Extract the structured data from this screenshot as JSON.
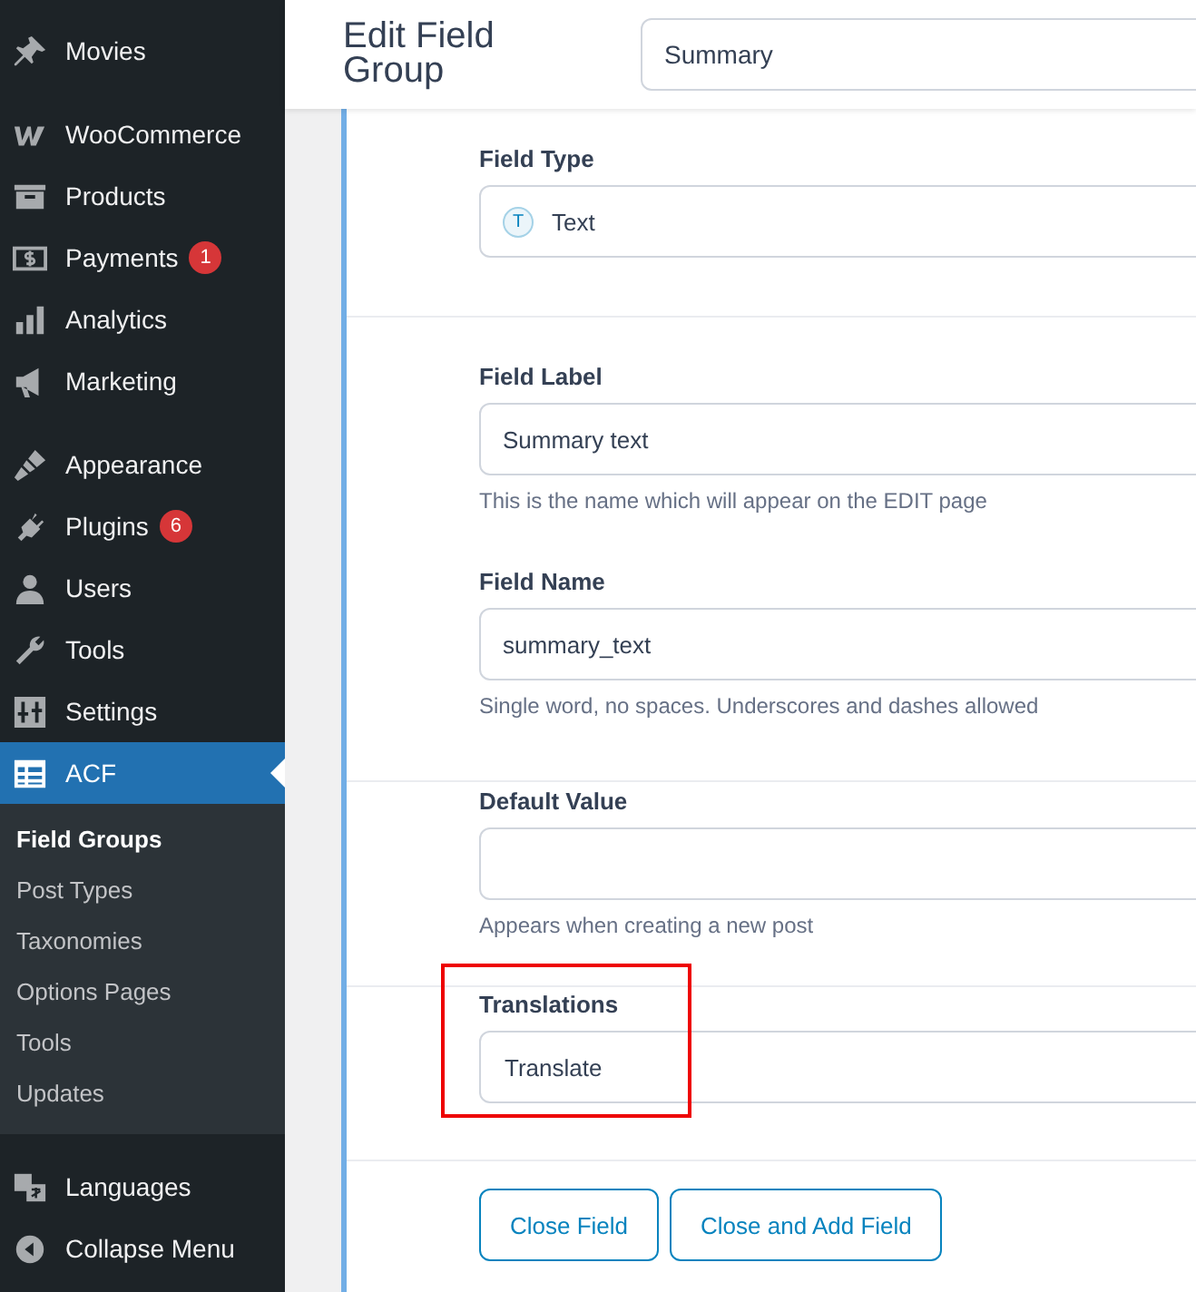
{
  "sidebar": {
    "groups": [
      [
        {
          "label": "Movies",
          "selected": false
        }
      ],
      [
        {
          "label": "WooCommerce",
          "selected": false
        },
        {
          "label": "Products",
          "selected": false
        },
        {
          "label": "Payments",
          "badge": "1",
          "selected": false
        },
        {
          "label": "Analytics",
          "selected": false
        },
        {
          "label": "Marketing",
          "selected": false
        }
      ],
      [
        {
          "label": "Appearance",
          "selected": false
        },
        {
          "label": "Plugins",
          "badge": "6",
          "selected": false
        },
        {
          "label": "Users",
          "selected": false
        },
        {
          "label": "Tools",
          "selected": false
        },
        {
          "label": "Settings",
          "selected": false
        },
        {
          "label": "ACF",
          "selected": true,
          "children": [
            {
              "label": "Field Groups",
              "selected": true
            },
            {
              "label": "Post Types",
              "selected": false
            },
            {
              "label": "Taxonomies",
              "selected": false
            },
            {
              "label": "Options Pages",
              "selected": false
            },
            {
              "label": "Tools",
              "selected": false
            },
            {
              "label": "Updates",
              "selected": false
            }
          ]
        }
      ],
      [
        {
          "label": "Languages",
          "selected": false
        },
        {
          "label": "Collapse Menu",
          "selected": false
        }
      ]
    ]
  },
  "header": {
    "title": "Edit Field Group",
    "title_input": {
      "value": "Summary"
    }
  },
  "sections": [
    {
      "fields": [
        {
          "kind": "type_select",
          "label": "Field Type",
          "icon_text": "T",
          "value": "Text"
        }
      ]
    },
    {
      "fields": [
        {
          "kind": "text",
          "label": "Field Label",
          "value": "Summary text",
          "hint": "This is the name which will appear on the EDIT page"
        },
        {
          "kind": "text",
          "label": "Field Name",
          "value": "summary_text",
          "hint": "Single word, no spaces. Underscores and dashes allowed"
        }
      ]
    },
    {
      "fields": [
        {
          "kind": "text",
          "label": "Default Value",
          "hint": "Appears when creating a new post"
        }
      ]
    },
    {
      "highlighted": true,
      "fields": [
        {
          "kind": "select",
          "label": "Translations",
          "value": "Translate"
        }
      ]
    }
  ],
  "buttons": [
    "Close Field",
    "Close and Add Field"
  ]
}
